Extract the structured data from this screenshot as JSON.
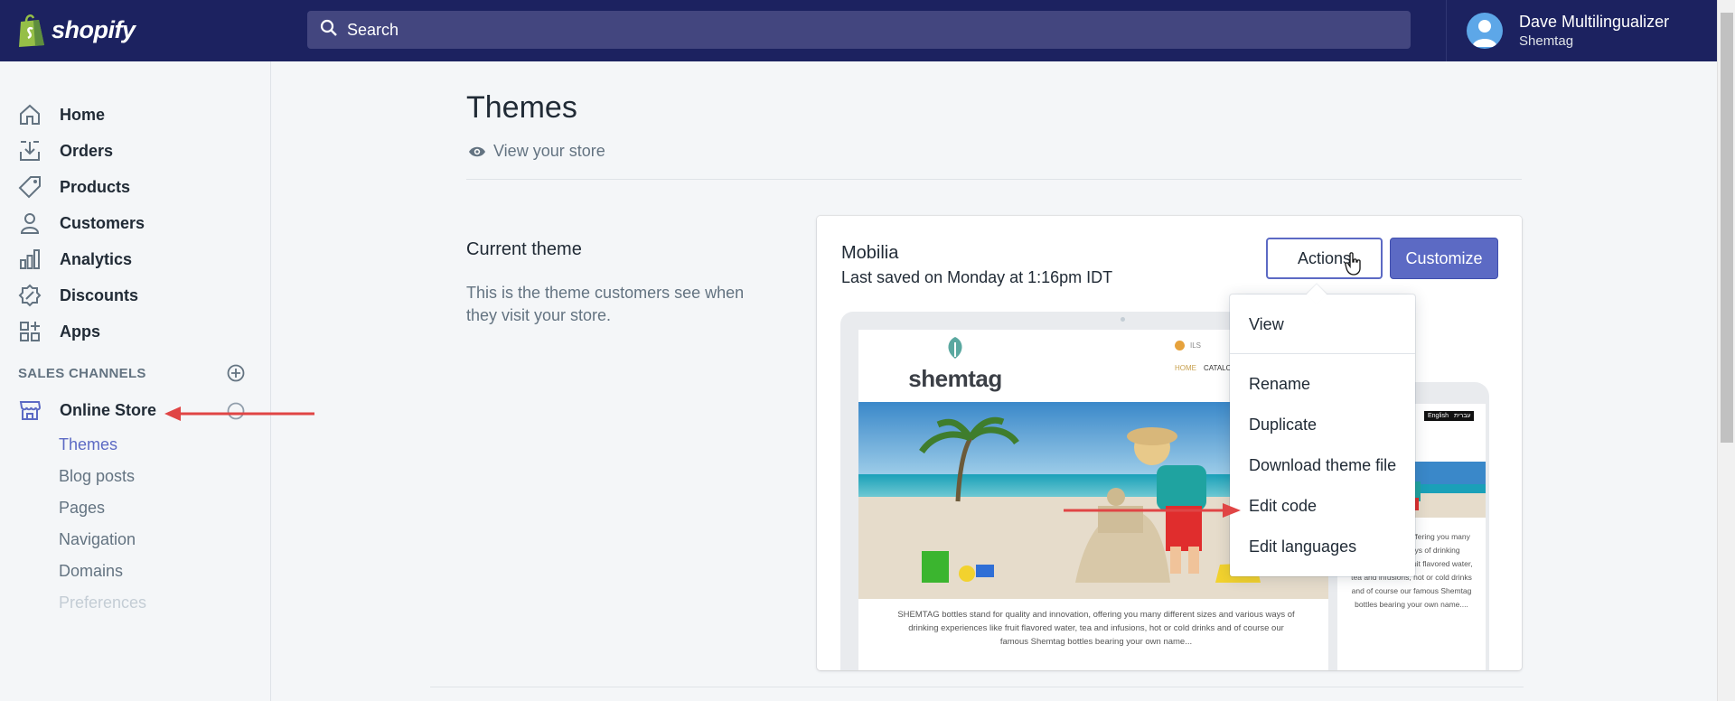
{
  "topbar": {
    "brand": "shopify",
    "search_placeholder": "Search",
    "user_name": "Dave Multilingualizer",
    "store_name": "Shemtag"
  },
  "sidebar": {
    "items": [
      {
        "label": "Home",
        "icon": "home-icon"
      },
      {
        "label": "Orders",
        "icon": "orders-icon"
      },
      {
        "label": "Products",
        "icon": "tag-icon"
      },
      {
        "label": "Customers",
        "icon": "person-icon"
      },
      {
        "label": "Analytics",
        "icon": "bar-chart-icon"
      },
      {
        "label": "Discounts",
        "icon": "discount-icon"
      },
      {
        "label": "Apps",
        "icon": "apps-icon"
      }
    ],
    "sales_channels_title": "SALES CHANNELS",
    "online_store": "Online Store",
    "sub_items": [
      "Themes",
      "Blog posts",
      "Pages",
      "Navigation",
      "Domains",
      "Preferences"
    ]
  },
  "main": {
    "title": "Themes",
    "view_store": "View your store",
    "current_theme_title": "Current theme",
    "current_theme_desc": "This is the theme customers see when they visit your store.",
    "theme": {
      "name": "Mobilia",
      "saved": "Last saved on Monday at 1:16pm IDT",
      "actions_label": "Actions",
      "customize_label": "Customize"
    },
    "preview": {
      "store_logo": "shemtag",
      "currency": "ILS",
      "nav_home": "HOME",
      "nav_catalog": "CATALOG",
      "caption": "SHEMTAG bottles stand for quality and innovation, offering you many different sizes and various ways of drinking experiences like fruit flavored water, tea and infusions, hot or cold drinks and of course our famous Shemtag bottles bearing your own name...",
      "mobile_caption": "stand for quality offering you many and various ways of drinking experiences like fruit flavored water, tea and infusions, hot or cold drinks and of course our famous Shemtag bottles bearing your own name....",
      "lang_en": "English",
      "lang_he": "עברית"
    }
  },
  "dropdown": {
    "items": [
      "View",
      "Rename",
      "Duplicate",
      "Download theme file",
      "Edit code",
      "Edit languages"
    ]
  },
  "colors": {
    "topbar": "#1c2260",
    "accent": "#5c6ac4",
    "annotation": "#e04545"
  }
}
